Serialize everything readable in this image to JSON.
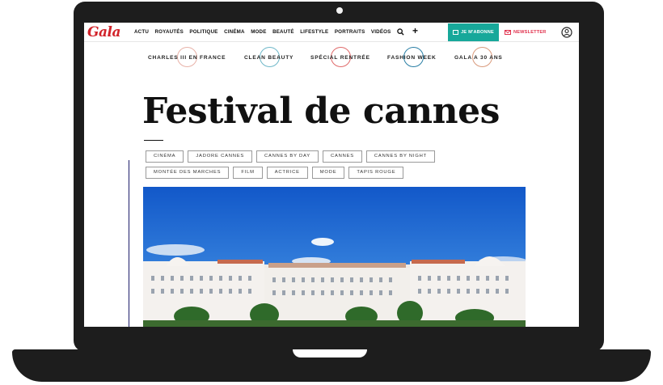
{
  "site": {
    "logo": "Gala"
  },
  "nav": {
    "items": [
      "ACTU",
      "ROYAUTÉS",
      "POLITIQUE",
      "CINÉMA",
      "MODE",
      "BEAUTÉ",
      "LIFESTYLE",
      "PORTRAITS",
      "VIDÉOS"
    ],
    "subscribe_label": "JE M'ABONNE",
    "newsletter_label": "NEWSLETTER"
  },
  "trending": [
    {
      "label": "CHARLES III EN FRANCE",
      "color": "#e8b2a8"
    },
    {
      "label": "CLEAN BEAUTY",
      "color": "#6fb8c9"
    },
    {
      "label": "SPÉCIAL RENTRÉE",
      "color": "#e06a6a"
    },
    {
      "label": "FASHION WEEK",
      "color": "#2a7fa5"
    },
    {
      "label": "GALA A 30 ANS",
      "color": "#d99a7c"
    }
  ],
  "page": {
    "title": "Festival de cannes"
  },
  "tags": {
    "row1": [
      "CINÉMA",
      "JADORE CANNES",
      "CANNES BY DAY",
      "CANNES",
      "CANNES BY NIGHT"
    ],
    "row2": [
      "MONTÉE DES MARCHES",
      "FILM",
      "ACTRICE",
      "MODE",
      "TAPIS ROUGE"
    ]
  },
  "colors": {
    "brand": "#d2232a",
    "accent": "#17a89a",
    "newsletter": "#e0314d",
    "sky": "#1a6fd6"
  },
  "icons": [
    "search-icon",
    "plus-icon",
    "mail-icon",
    "account-icon",
    "camera-icon"
  ]
}
